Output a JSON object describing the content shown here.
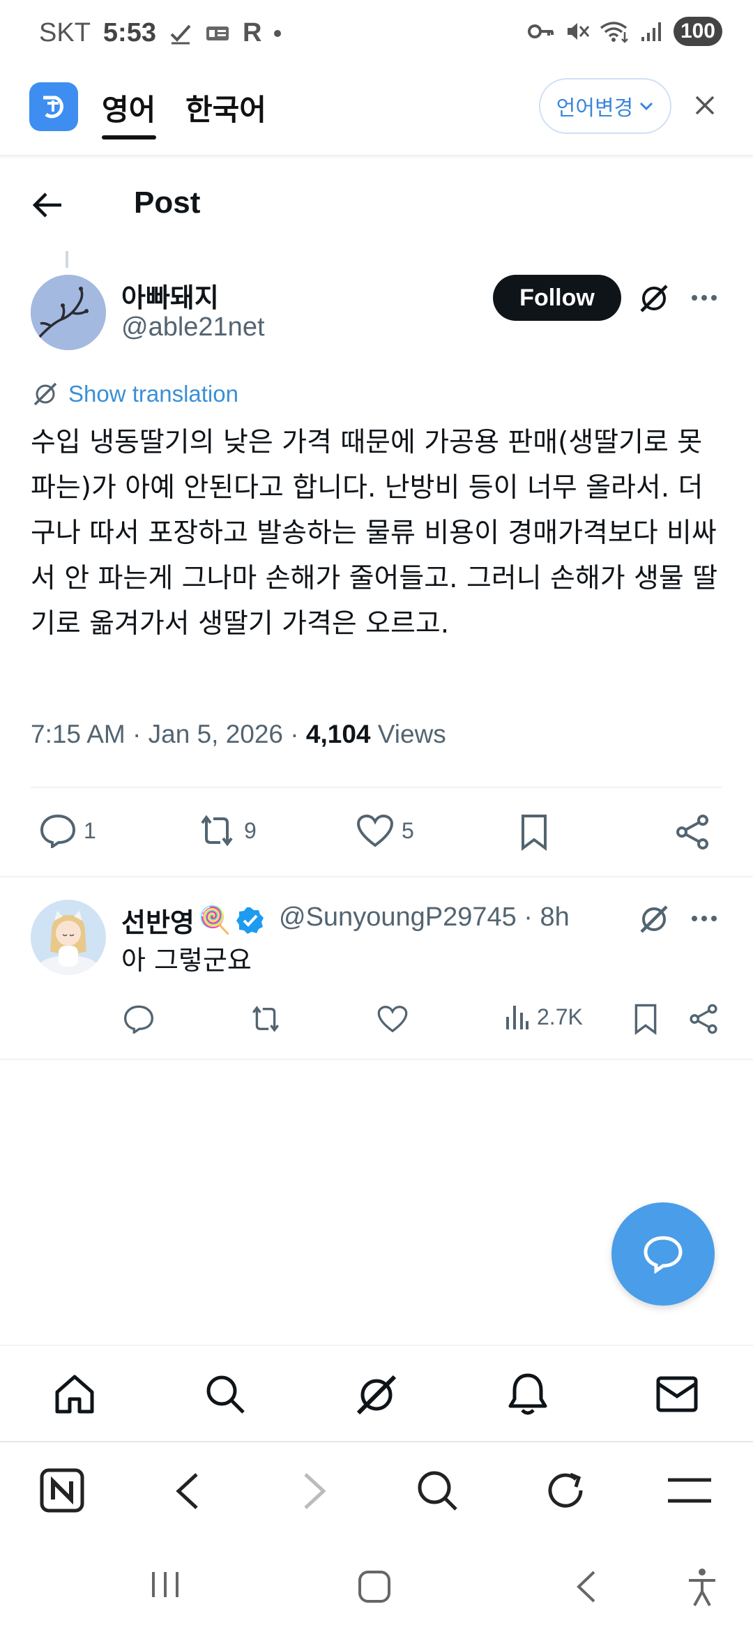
{
  "status_bar": {
    "carrier": "SKT",
    "time": "5:53",
    "battery": "100"
  },
  "translate_bar": {
    "tab_english": "영어",
    "tab_korean": "한국어",
    "change_language": "언어변경"
  },
  "header": {
    "title": "Post"
  },
  "post": {
    "author_name": "아빠돼지",
    "author_handle": "@able21net",
    "follow_label": "Follow",
    "show_translation": "Show translation",
    "body": "수입 냉동딸기의 낮은 가격 때문에 가공용 판매(생딸기로 못 파는)가 아예 안된다고 합니다. 난방비 등이 너무 올라서. 더구나 따서 포장하고 발송하는 물류 비용이 경매가격보다 비싸서 안 파는게 그나마 손해가 줄어들고. 그러니 손해가 생물 딸기로 옮겨가서 생딸기 가격은 오르고.",
    "timestamp": "7:15 AM · Jan 5, 2026 · ",
    "views_count": "4,104",
    "views_label": " Views",
    "replies": "1",
    "reposts": "9",
    "likes": "5"
  },
  "reply": {
    "name": "선반영",
    "emoji": "🍭",
    "handle_time": "@SunyoungP29745 · 8h",
    "text": "아 그렇군요",
    "views": "2.7K"
  },
  "icons": {
    "accent": "#1d9bf0",
    "fab_color": "#4a9de8"
  }
}
